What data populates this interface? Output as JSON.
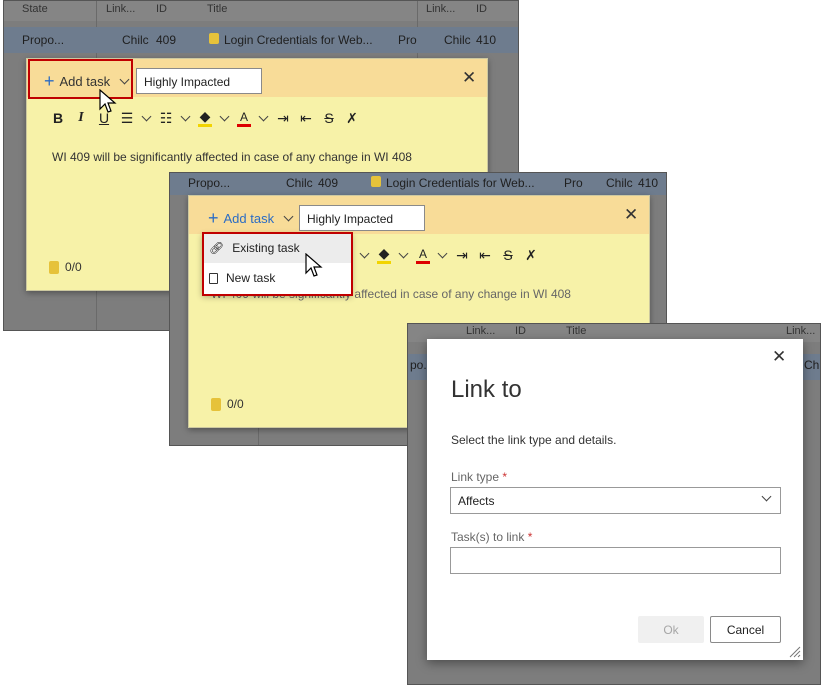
{
  "grid": {
    "headers": [
      "State",
      "Link...",
      "ID",
      "Title",
      "Link...",
      "ID"
    ],
    "row": {
      "state": "Propo...",
      "link": "Chilc",
      "id": "409",
      "title": "Login Credentials for Web...",
      "state2": "Pro",
      "link2": "Chilc",
      "id2": "410"
    }
  },
  "panel1": {
    "add_task_label": "Add task",
    "tag_value": "Highly Impacted",
    "note_text": "WI 409 will be significantly affected in case of any change in WI 408",
    "task_count": "0/0"
  },
  "panel2": {
    "add_task_label": "Add task",
    "tag_value": "Highly Impacted",
    "note_text": "WI 409 will be significantly affected in case of any change in WI 408",
    "task_count": "0/0",
    "menu": {
      "existing": "Existing task",
      "new": "New task"
    },
    "row": {
      "state": "Propo...",
      "link": "Chilc",
      "id": "409",
      "title": "Login Credentials for Web...",
      "state2": "Pro",
      "link2": "Chilc",
      "id2": "410"
    }
  },
  "panel3": {
    "headers": [
      "Link...",
      "ID",
      "Title",
      "Link..."
    ],
    "bg_row": "po...",
    "bg_chi": "Chi",
    "dialog": {
      "title": "Link to",
      "subtitle": "Select the link type and details.",
      "link_type_label": "Link type",
      "link_type_value": "Affects",
      "tasks_label": "Task(s) to link",
      "tasks_value": "",
      "required_mark": "*",
      "ok_label": "Ok",
      "cancel_label": "Cancel"
    }
  },
  "colors": {
    "accent": "#2b6cc4",
    "highlight_box": "#c00000",
    "note_bg": "#f7f2a8",
    "note_header": "#f8dc98"
  }
}
